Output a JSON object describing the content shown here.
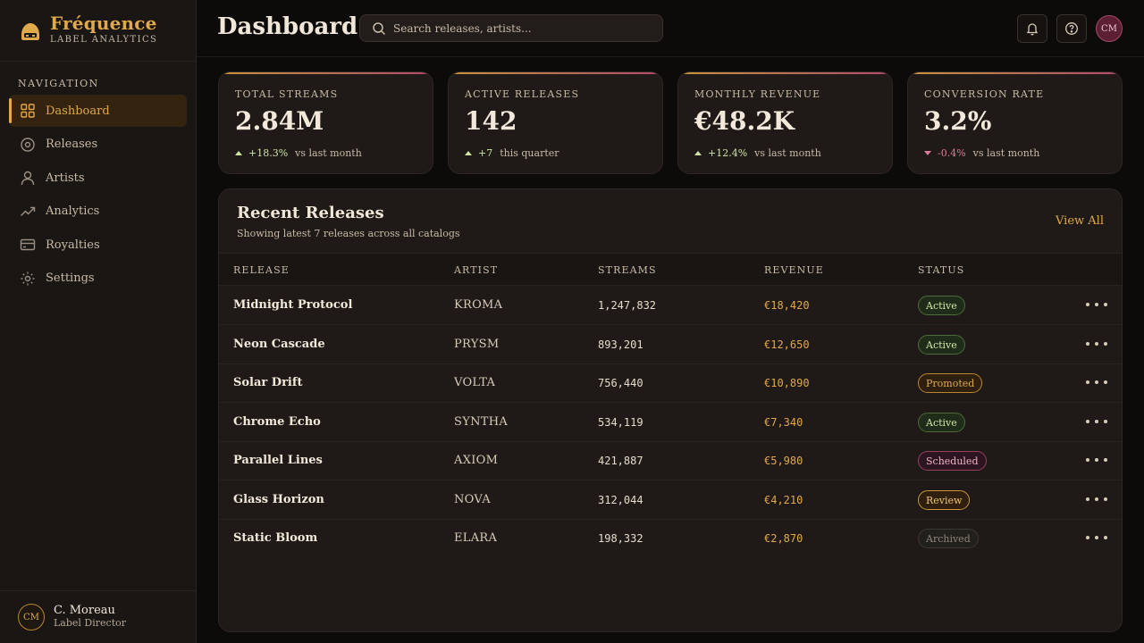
{
  "brand": {
    "name": "Fréquence",
    "subtitle": "LABEL ANALYTICS"
  },
  "sidebar": {
    "heading": "NAVIGATION",
    "items": [
      {
        "label": "Dashboard",
        "icon": "grid-icon",
        "active": true
      },
      {
        "label": "Releases",
        "icon": "disc-icon"
      },
      {
        "label": "Artists",
        "icon": "user-icon"
      },
      {
        "label": "Analytics",
        "icon": "trend-icon"
      },
      {
        "label": "Royalties",
        "icon": "card-icon"
      },
      {
        "label": "Settings",
        "icon": "gear-icon"
      }
    ],
    "user": {
      "initials": "CM",
      "name": "C. Moreau",
      "role": "Label Director"
    }
  },
  "header": {
    "title": "Dashboard",
    "search_placeholder": "Search releases, artists...",
    "avatar_initials": "CM"
  },
  "stats": [
    {
      "label": "TOTAL STREAMS",
      "value": "2.84M",
      "delta": "+18.3%",
      "direction": "up",
      "note": "vs last month"
    },
    {
      "label": "ACTIVE RELEASES",
      "value": "142",
      "delta": "+7",
      "direction": "up",
      "note": "this quarter"
    },
    {
      "label": "MONTHLY REVENUE",
      "value": "€48.2K",
      "delta": "+12.4%",
      "direction": "up",
      "note": "vs last month"
    },
    {
      "label": "CONVERSION RATE",
      "value": "3.2%",
      "delta": "-0.4%",
      "direction": "down",
      "note": "vs last month"
    }
  ],
  "releases": {
    "title": "Recent Releases",
    "subtitle": "Showing latest 7 releases across all catalogs",
    "view_all": "View All",
    "columns": [
      "RELEASE",
      "ARTIST",
      "STREAMS",
      "REVENUE",
      "STATUS"
    ],
    "rows": [
      {
        "release": "Midnight Protocol",
        "artist": "KROMA",
        "streams": "1,247,832",
        "revenue": "€18,420",
        "status": "Active"
      },
      {
        "release": "Neon Cascade",
        "artist": "PRYSM",
        "streams": "893,201",
        "revenue": "€12,650",
        "status": "Active"
      },
      {
        "release": "Solar Drift",
        "artist": "VOLTA",
        "streams": "756,440",
        "revenue": "€10,890",
        "status": "Promoted"
      },
      {
        "release": "Chrome Echo",
        "artist": "SYNTHA",
        "streams": "534,119",
        "revenue": "€7,340",
        "status": "Active"
      },
      {
        "release": "Parallel Lines",
        "artist": "AXIOM",
        "streams": "421,887",
        "revenue": "€5,980",
        "status": "Scheduled"
      },
      {
        "release": "Glass Horizon",
        "artist": "NOVA",
        "streams": "312,044",
        "revenue": "€4,210",
        "status": "Review"
      },
      {
        "release": "Static Bloom",
        "artist": "ELARA",
        "streams": "198,332",
        "revenue": "€2,870",
        "status": "Archived"
      }
    ]
  },
  "colors": {
    "accent": "#e0a94b",
    "background": "#0d0b0a",
    "positive": "#cfe6a8",
    "negative": "#e07a9a"
  }
}
